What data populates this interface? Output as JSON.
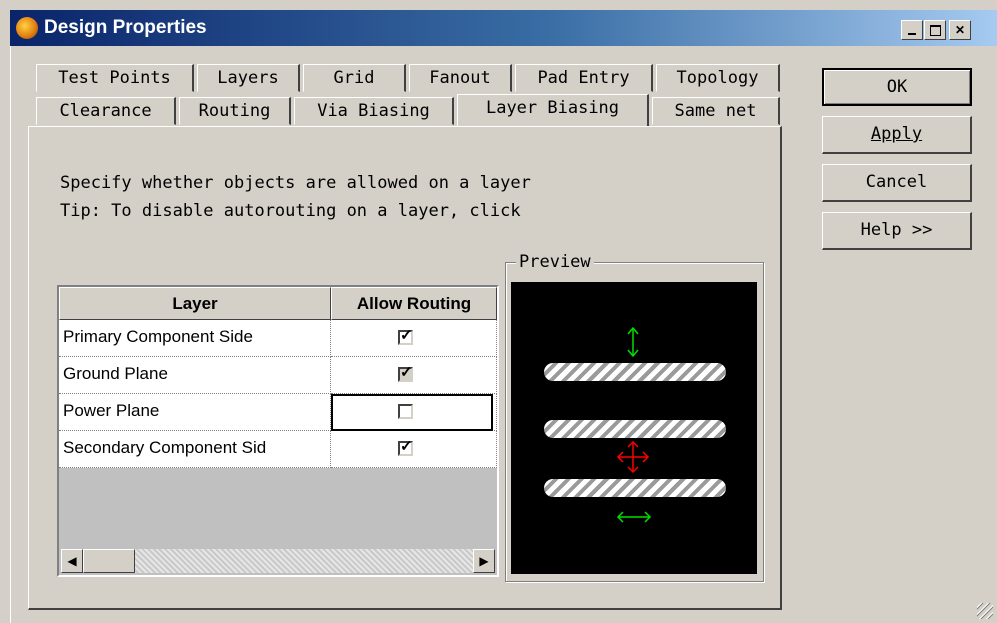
{
  "window": {
    "title": "Design Properties",
    "caption_buttons": [
      "minimize",
      "maximize",
      "close"
    ]
  },
  "tabs": {
    "row_back": [
      "Test Points",
      "Layers",
      "Grid",
      "Fanout",
      "Pad Entry",
      "Topology"
    ],
    "row_front": [
      "Clearance",
      "Routing",
      "Via Biasing",
      "Layer Biasing",
      "Same net"
    ],
    "active": "Layer Biasing"
  },
  "description": {
    "line1": "Specify whether objects are allowed on a layer",
    "line2": "Tip: To disable autorouting on a layer, click"
  },
  "grid": {
    "columns": [
      "Layer",
      "Allow Routing"
    ],
    "rows": [
      {
        "layer": "Primary Component Side",
        "allow_routing": true,
        "disabled": false
      },
      {
        "layer": "Ground Plane",
        "allow_routing": true,
        "disabled": true
      },
      {
        "layer": "Power Plane",
        "allow_routing": false,
        "disabled": false
      },
      {
        "layer": "Secondary Component Sid",
        "allow_routing": true,
        "disabled": false
      }
    ],
    "focused_row": 2
  },
  "preview": {
    "label": "Preview",
    "colors": {
      "background": "#000000",
      "arrow_allowed": "#00e000",
      "arrow_blocked": "#ff0000"
    }
  },
  "buttons": {
    "ok": "OK",
    "apply": "Apply",
    "cancel": "Cancel",
    "help": "Help >>"
  }
}
